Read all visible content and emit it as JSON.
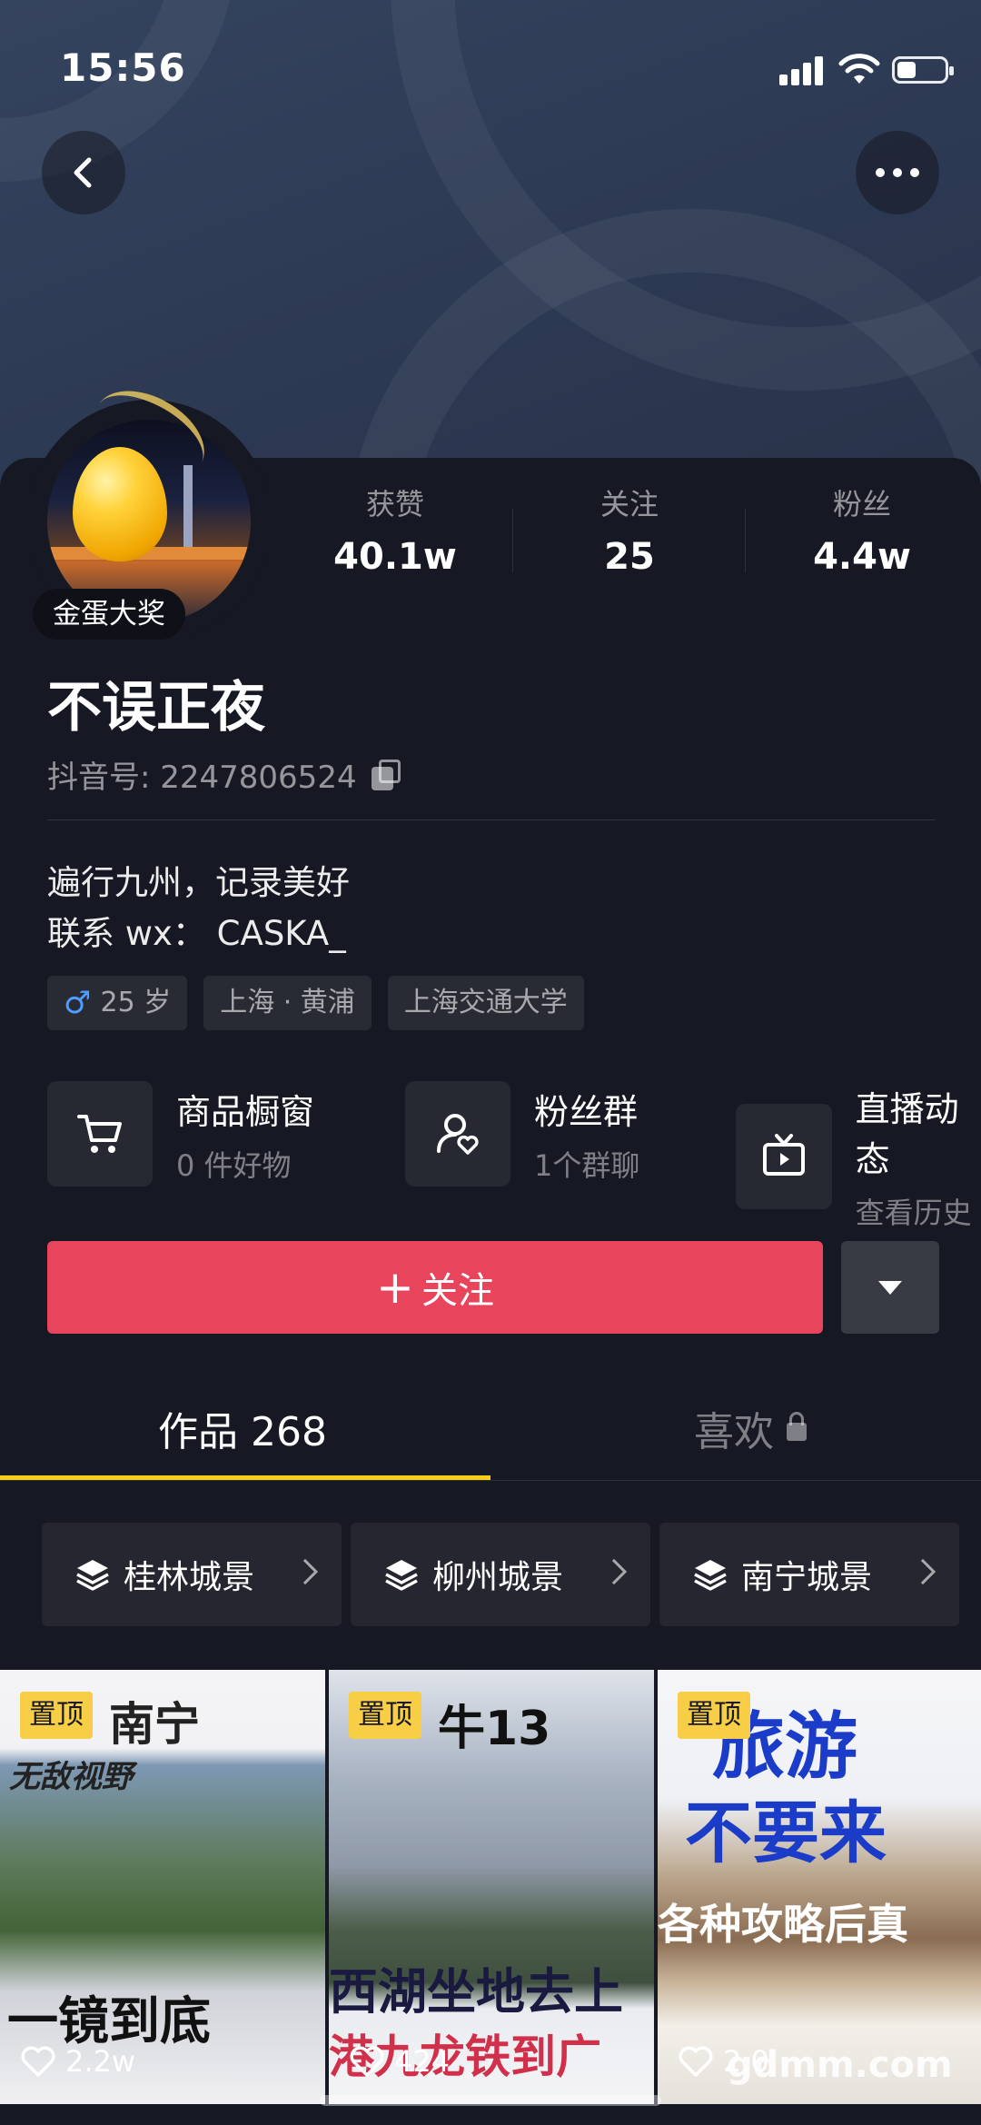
{
  "status": {
    "time": "15:56"
  },
  "profile": {
    "badge": "金蛋大奖",
    "nickname": "不误正夜",
    "douyin_id": "抖音号: 2247806524",
    "bio_line1": "遍行九州，记录美好",
    "bio_line2": "联系 wx：  CASKA_",
    "tags": {
      "age": "25 岁",
      "location": "上海 · 黄浦",
      "school": "上海交通大学"
    }
  },
  "stats": [
    {
      "label": "获赞",
      "value": "40.1w"
    },
    {
      "label": "关注",
      "value": "25"
    },
    {
      "label": "粉丝",
      "value": "4.4w"
    }
  ],
  "features": [
    {
      "title": "商品橱窗",
      "subtitle": "0 件好物",
      "icon": "cart-icon"
    },
    {
      "title": "粉丝群",
      "subtitle": "1个群聊",
      "icon": "fan-group-icon"
    },
    {
      "title": "直播动态",
      "subtitle": "查看历史",
      "icon": "tv-icon"
    }
  ],
  "actions": {
    "follow_label": "关注",
    "follow_plus": "+"
  },
  "tabs": {
    "works": "作品 268",
    "likes": "喜欢"
  },
  "collections": [
    {
      "name": "桂林城景"
    },
    {
      "name": "柳州城景"
    },
    {
      "name": "南宁城景"
    }
  ],
  "videos": [
    {
      "pin": "置顶",
      "title_top": "南宁",
      "subtitle": "无敌视野",
      "title_bottom": "一镜到底",
      "likes": "2.2w"
    },
    {
      "pin": "置顶",
      "title_top": "牛13",
      "subtitle": "西湖坐地去上",
      "title_bottom": "港九龙铁到广",
      "likes": "424"
    },
    {
      "pin": "置顶",
      "title_top": "旅游",
      "subtitle": "不要来",
      "title_bottom": "各种攻略后真",
      "likes": "2.0"
    }
  ],
  "watermark": "gdmm.com",
  "colors": {
    "accent": "#e8445c",
    "pin": "#f7ce46",
    "background": "#161823",
    "tab_indicator": "#facc15"
  }
}
